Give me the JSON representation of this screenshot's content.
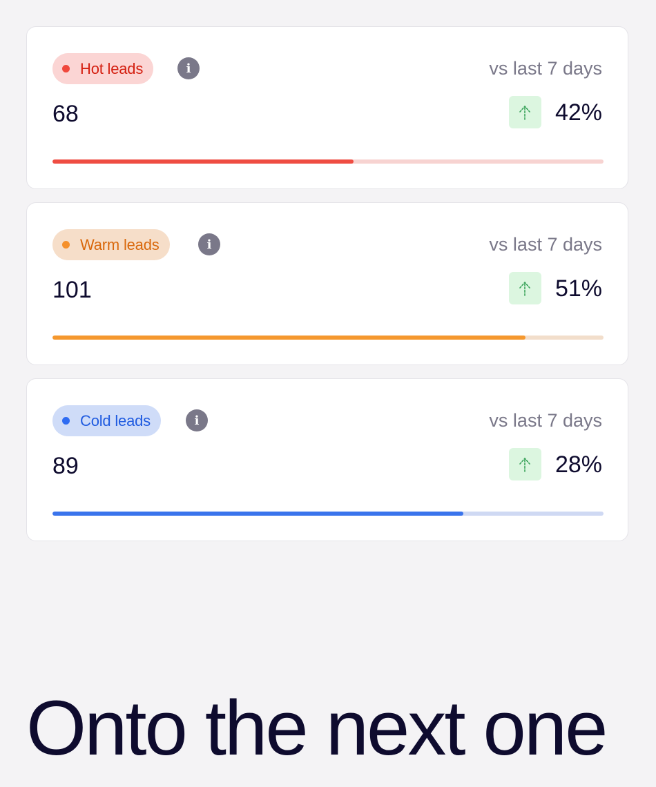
{
  "cards": [
    {
      "label": "Hot leads",
      "count": "68",
      "comparison": "vs last 7 days",
      "change": "42%",
      "trend_icon": "arrow-up-icon",
      "progress": 0.546,
      "colors": {
        "pill_bg": "#fbd5d4",
        "pill_text": "#d41f10",
        "dot": "#f0483c",
        "fill": "#ef4d42",
        "track": "#f7d3d1"
      }
    },
    {
      "label": "Warm leads",
      "count": "101",
      "comparison": "vs last 7 days",
      "change": "51%",
      "trend_icon": "arrow-up-icon",
      "progress": 0.858,
      "colors": {
        "pill_bg": "#f6dec9",
        "pill_text": "#d9680c",
        "dot": "#f5902b",
        "fill": "#f5982e",
        "track": "#f2decb"
      }
    },
    {
      "label": "Cold leads",
      "count": "89",
      "comparison": "vs last 7 days",
      "change": "28%",
      "trend_icon": "arrow-up-icon",
      "progress": 0.745,
      "colors": {
        "pill_bg": "#cfdcf8",
        "pill_text": "#1f5be0",
        "dot": "#2f6cf2",
        "fill": "#3a74ec",
        "track": "#cfd9f3"
      }
    }
  ],
  "headline": "Onto the next one"
}
